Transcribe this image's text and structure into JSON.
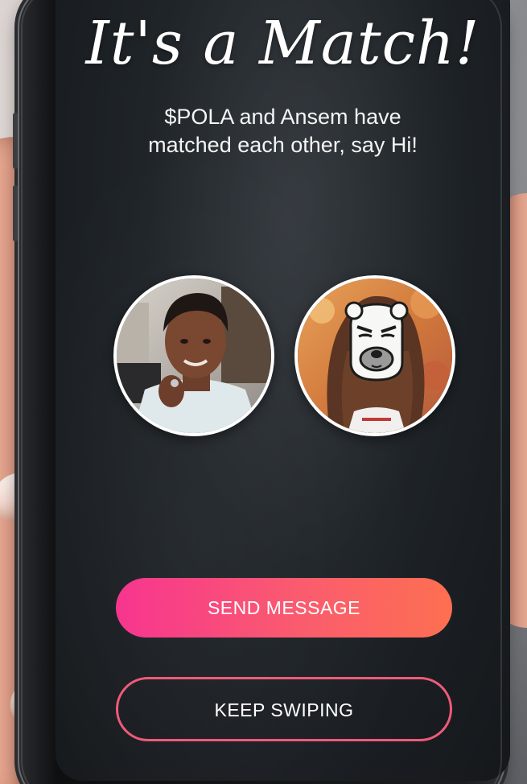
{
  "match": {
    "title": "It's a Match!",
    "subtitle_line1": "$POLA and Ansem have",
    "subtitle_line2": "matched each other, say Hi!"
  },
  "profiles": {
    "left": {
      "name": "Ansem"
    },
    "right": {
      "name": "$POLA"
    }
  },
  "buttons": {
    "send_message": "SEND MESSAGE",
    "keep_swiping": "KEEP SWIPING"
  },
  "colors": {
    "accent_start": "#f7358f",
    "accent_end": "#fd6f51",
    "screen_bg": "#1f2428"
  }
}
